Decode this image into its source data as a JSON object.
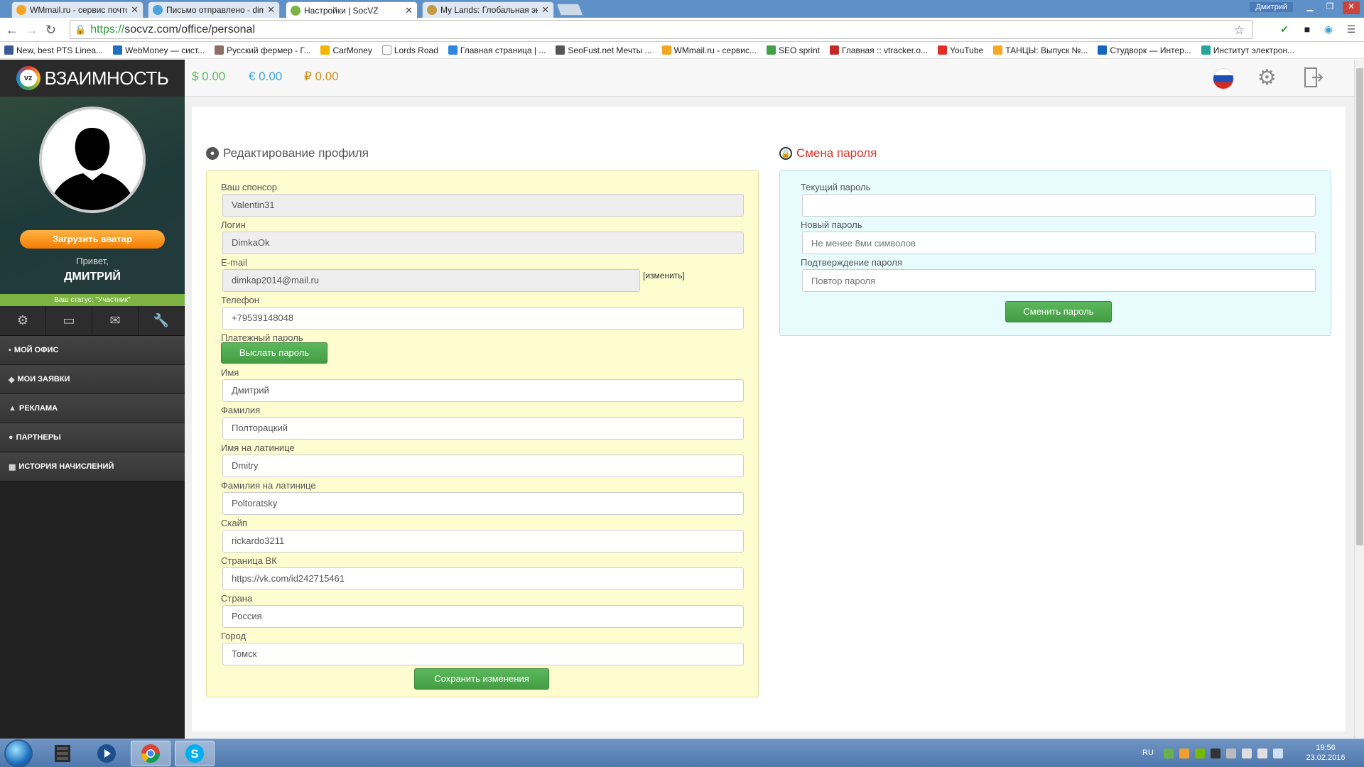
{
  "browser": {
    "tabs": [
      {
        "title": "WMmail.ru - сервис почто",
        "color": "#f4a623"
      },
      {
        "title": "Письмо отправлено - dim",
        "color": "#4aa3df"
      },
      {
        "title": "Настройки | SocVZ",
        "color": "#7cb342"
      },
      {
        "title": "My Lands: Глобальная экс",
        "color": "#c49a42"
      }
    ],
    "window_user": "Дмитрий",
    "url_scheme": "https://",
    "url_rest": "socvz.com/office/personal",
    "bookmarks": [
      {
        "label": "New, best PTS Linea...",
        "color": "#3b5998"
      },
      {
        "label": "WebMoney — сист...",
        "color": "#1e6fc0"
      },
      {
        "label": "Русский фермер - Г...",
        "color": "#8d6e63"
      },
      {
        "label": "CarMoney",
        "color": "#f4b400"
      },
      {
        "label": "Lords Road",
        "color": "#ffffff"
      },
      {
        "label": "Главная страница | ...",
        "color": "#2e86de"
      },
      {
        "label": "SeoFust.net Мечты ...",
        "color": "#555555"
      },
      {
        "label": "WMmail.ru - сервис...",
        "color": "#f4a623"
      },
      {
        "label": "SEO sprint",
        "color": "#43a047"
      },
      {
        "label": "Главная :: vtracker.o...",
        "color": "#c62828"
      },
      {
        "label": "YouTube",
        "color": "#e52d27"
      },
      {
        "label": "ТАНЦЫ: Выпуск №...",
        "color": "#f9a825"
      },
      {
        "label": "Студворк — Интер...",
        "color": "#1565c0"
      },
      {
        "label": "Институт электрон...",
        "color": "#26a69a"
      }
    ]
  },
  "sidebar": {
    "logo_badge": "vz",
    "logo_text": "ВЗАИМНОСТЬ",
    "upload_label": "Загрузить аватар",
    "hello": "Привет,",
    "username": "ДМИТРИЙ",
    "status": "Ваш статус: \"Участник\"",
    "icons": [
      "gear-icon",
      "card-icon",
      "mail-icon",
      "wrench-icon"
    ],
    "menu": [
      {
        "label": "МОЙ ОФИС",
        "icon": "▪"
      },
      {
        "label": "МОИ ЗАЯВКИ",
        "icon": "◆"
      },
      {
        "label": "РЕКЛАМА",
        "icon": "▲"
      },
      {
        "label": "ПАРТНЕРЫ",
        "icon": "●"
      },
      {
        "label": "ИСТОРИЯ НАЧИСЛЕНИЙ",
        "icon": "▦"
      }
    ]
  },
  "topbar": {
    "balances": [
      {
        "text": "$ 0.00",
        "color": "#5cb85c"
      },
      {
        "text": "€ 0.00",
        "color": "#3aa3d8"
      },
      {
        "text": "₽ 0.00",
        "color": "#d08a18"
      }
    ]
  },
  "profile": {
    "title": "Редактирование профиля",
    "sponsor_label": "Ваш спонсор",
    "sponsor_value": "Valentin31",
    "login_label": "Логин",
    "login_value": "DimkaOk",
    "email_label": "E-mail",
    "email_value": "dimkap2014@mail.ru",
    "email_change": "[изменить]",
    "phone_label": "Телефон",
    "phone_value": "+79539148048",
    "paypass_label": "Платежный пароль",
    "paypass_button": "Выслать пароль",
    "name_label": "Имя",
    "name_value": "Дмитрий",
    "surname_label": "Фамилия",
    "surname_value": "Полторацкий",
    "name_lat_label": "Имя на латинице",
    "name_lat_value": "Dmitry",
    "surname_lat_label": "Фамилия на латинице",
    "surname_lat_value": "Poltoratsky",
    "skype_label": "Скайп",
    "skype_value": "rickardo3211",
    "vk_label": "Страница ВК",
    "vk_value": "https://vk.com/id242715461",
    "country_label": "Страна",
    "country_value": "Россия",
    "city_label": "Город",
    "city_value": "Томск",
    "save_button": "Сохранить изменения"
  },
  "password": {
    "title": "Смена пароля",
    "current_label": "Текущий пароль",
    "current_value": "",
    "new_label": "Новый пароль",
    "new_placeholder": "Не менее 8ми символов",
    "confirm_label": "Подтверждение пароля",
    "confirm_placeholder": "Повтор пароля",
    "submit_button": "Сменить пароль"
  },
  "taskbar": {
    "lang": "RU",
    "time": "19:56",
    "date": "23.02.2016"
  }
}
